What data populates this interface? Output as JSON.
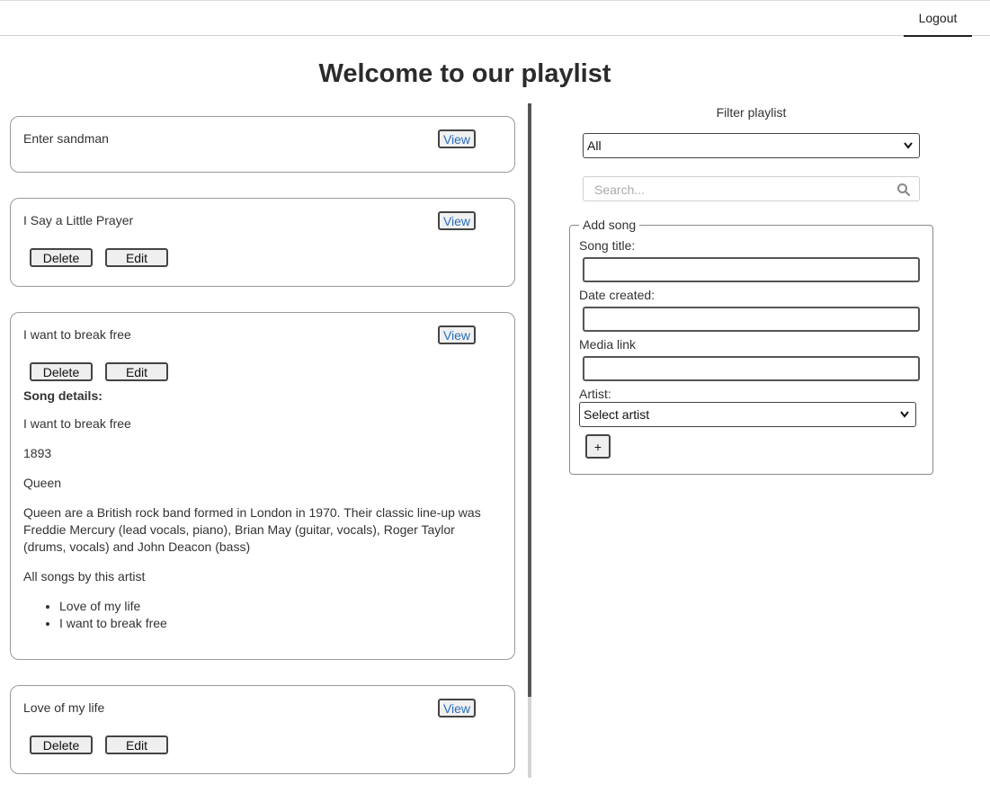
{
  "header": {
    "logout_label": "Logout"
  },
  "page_title": "Welcome to our playlist",
  "songs": [
    {
      "title": "Enter sandman",
      "view_label": "View"
    },
    {
      "title": "I Say a Little Prayer",
      "view_label": "View",
      "delete_label": "Delete",
      "edit_label": "Edit"
    },
    {
      "title": "I want to break free",
      "view_label": "View",
      "delete_label": "Delete",
      "edit_label": "Edit",
      "details": {
        "heading": "Song details:",
        "song_title": "I want to break free",
        "date": "1893",
        "artist": "Queen",
        "bio": "Queen are a British rock band formed in London in 1970. Their classic line-up was Freddie Mercury (lead vocals, piano), Brian May (guitar, vocals), Roger Taylor (drums, vocals) and John Deacon (bass)",
        "all_songs_label": "All songs by this artist",
        "all_songs": [
          "Love of my life",
          "I want to break free"
        ]
      }
    },
    {
      "title": "Love of my life",
      "view_label": "View",
      "delete_label": "Delete",
      "edit_label": "Edit"
    }
  ],
  "filter": {
    "label": "Filter playlist",
    "selected": "All",
    "search_placeholder": "Search..."
  },
  "add_song": {
    "legend": "Add song",
    "song_title_label": "Song title:",
    "date_created_label": "Date created:",
    "media_link_label": "Media link",
    "artist_label": "Artist:",
    "artist_selected": "Select artist",
    "add_button": "+"
  }
}
